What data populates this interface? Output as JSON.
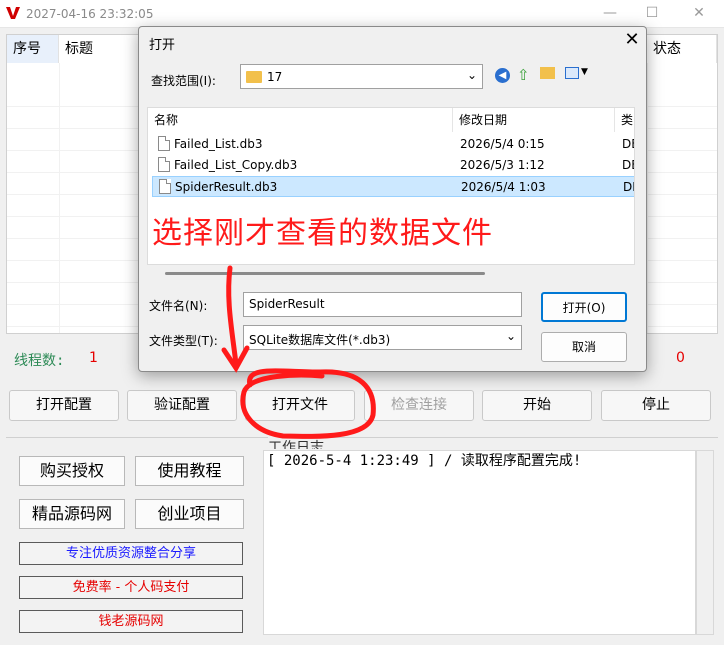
{
  "window": {
    "title": "2027-04-16 23:32:05",
    "min": "—",
    "max": "☐",
    "close": "✕"
  },
  "table": {
    "headers": [
      "序号",
      "标题",
      "状态"
    ]
  },
  "stats": {
    "threads_label": "线程数:",
    "threads_value": "1",
    "other_value": "0"
  },
  "buttons": {
    "open_config": "打开配置",
    "verify_config": "验证配置",
    "open_file": "打开文件",
    "check_connection": "检查连接",
    "start": "开始",
    "stop": "停止"
  },
  "left_panel": {
    "buy_license": "购买授权",
    "tutorial": "使用教程",
    "source_site": "精品源码网",
    "startup_project": "创业项目",
    "links": [
      {
        "text": "专注优质资源整合分享",
        "color": "#1a1aff"
      },
      {
        "text": "免费率 - 个人码支付",
        "color": "#e60000"
      },
      {
        "text": "钱老源码网",
        "color": "#e60000"
      }
    ]
  },
  "log": {
    "caption": "工作日志",
    "lines": [
      "[ 2026-5-4 1:23:49 ] / 读取程序配置完成!"
    ]
  },
  "dialog": {
    "title": "打开",
    "look_in_label": "查找范围(I):",
    "look_in_value": "17",
    "columns": {
      "name": "名称",
      "date": "修改日期",
      "type": "类"
    },
    "files": [
      {
        "name": "Failed_List.db3",
        "date": "2026/5/4 0:15",
        "type": "DE",
        "selected": false
      },
      {
        "name": "Failed_List_Copy.db3",
        "date": "2026/5/3 1:12",
        "type": "DE",
        "selected": false
      },
      {
        "name": "SpiderResult.db3",
        "date": "2026/5/4 1:03",
        "type": "DE",
        "selected": true
      }
    ],
    "filename_label": "文件名(N):",
    "filename_value": "SpiderResult",
    "filetype_label": "文件类型(T):",
    "filetype_value": "SQLite数据库文件(*.db3)",
    "open_button": "打开(O)",
    "cancel_button": "取消"
  },
  "annotation": {
    "text": "选择刚才查看的数据文件",
    "color": "#ff1a1a"
  },
  "colors": {
    "accent_red": "#e60000",
    "stat_green": "#2e8b57",
    "selection": "#cce8ff"
  }
}
